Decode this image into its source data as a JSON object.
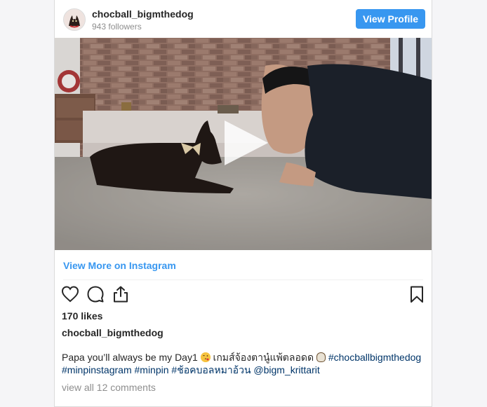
{
  "post": {
    "username": "chocball_bigmthedog",
    "followers": "943 followers",
    "view_profile_label": "View Profile",
    "view_more_label": "View More on Instagram",
    "likes": "170 likes",
    "owner": "chocball_bigmthedog",
    "caption": {
      "text1": "Papa you’ll always be my Day1",
      "text2": "เกมส์จ้องตานู๋แพ้ตลอดด",
      "tag1": "#chocballbigmthedog",
      "tag2": "#minpinstagram",
      "tag3": "#minpin",
      "tag4": "#ช้อคบอลหมาอ้วน",
      "mention": "@bigm_krittarit"
    },
    "comments_link": "view all 12 comments"
  },
  "colors": {
    "accent": "#3897f0",
    "link_dark": "#003569",
    "muted": "#8e8e8e"
  },
  "icons": [
    "avatar",
    "play-icon",
    "heart-icon",
    "comment-icon",
    "share-icon",
    "bookmark-icon",
    "winking-kiss-emoji",
    "dog-emoji"
  ]
}
